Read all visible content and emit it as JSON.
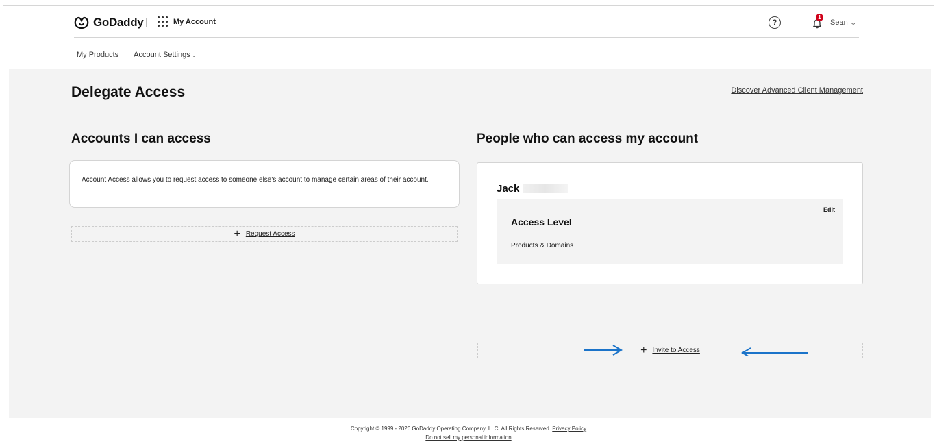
{
  "header": {
    "brand": "GoDaddy",
    "app_label": "My Account",
    "help_icon_glyph": "?",
    "notification_count": "1",
    "user_name": "Sean"
  },
  "nav": {
    "items": [
      "My Products",
      "Account Settings"
    ]
  },
  "page": {
    "title": "Delegate Access",
    "discover_link": "Discover Advanced Client Management"
  },
  "left": {
    "title": "Accounts I can access",
    "info_text": "Account Access allows you to request access to someone else's account to manage certain areas of their account.",
    "request_label": "Request Access"
  },
  "right": {
    "title": "People who can access my account",
    "person": {
      "name": "Jack",
      "edit_label": "Edit",
      "access_level_title": "Access Level",
      "access_level_value": "Products & Domains"
    },
    "invite_label": "Invite to Access"
  },
  "footer": {
    "copyright": "Copyright © 1999 - 2026 GoDaddy Operating Company, LLC. All Rights Reserved.",
    "privacy_link": "Privacy Policy",
    "do_not_sell_link": "Do not sell my personal information"
  },
  "colors": {
    "page_bg": "#f3f3f3",
    "badge": "#d0021b",
    "annotation_arrow": "#1a73c9"
  },
  "icons": [
    "godaddy-logo-icon",
    "apps-grid-icon",
    "help-icon",
    "bell-icon",
    "chevron-down-icon",
    "plus-icon",
    "arrow-right-icon",
    "arrow-left-icon"
  ]
}
